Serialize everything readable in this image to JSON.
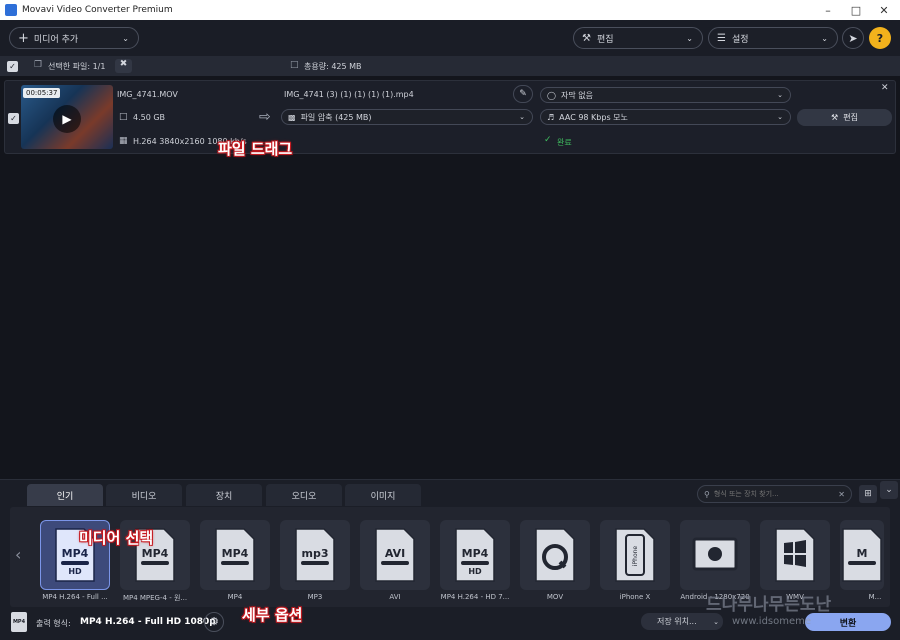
{
  "window": {
    "title": "Movavi Video Converter Premium"
  },
  "toolbar": {
    "add_media_label": "미디어 추가",
    "edit_label": "편집",
    "settings_label": "설정",
    "help_label": "?"
  },
  "selection_bar": {
    "selected_label": "선택한 파일: 1/1",
    "total_size_label": "총용량: 425 MB"
  },
  "file": {
    "duration": "00:05:37",
    "source_name": "IMG_4741.MOV",
    "source_size": "4.50 GB",
    "source_codec": "H.264 3840x2160 1080 kb/s",
    "output_name": "IMG_4741 (3) (1) (1) (1) (1).mp4",
    "compress_label": "파일 압축 (425 MB)",
    "subtitle_label": "자막 없음",
    "audio_label": "AAC 98 Kbps 모노",
    "edit_label": "편집",
    "status_label": "완료"
  },
  "annotations": {
    "file_drag": "파일 드래그",
    "media_select": "미디어 선택",
    "detail_options": "세부 옵션"
  },
  "tabs": [
    "인기",
    "비디오",
    "장치",
    "오디오",
    "이미지"
  ],
  "search": {
    "placeholder": "형식 또는 장치 찾기..."
  },
  "presets": [
    {
      "label": "MP4 H.264 - Full ...",
      "badge": "MP4"
    },
    {
      "label": "MP4 MPEG-4 - 원...",
      "badge": "MP4"
    },
    {
      "label": "MP4",
      "badge": "MP4"
    },
    {
      "label": "MP3",
      "badge": "mp3"
    },
    {
      "label": "AVI",
      "badge": "AVI"
    },
    {
      "label": "MP4 H.264 - HD 7...",
      "badge": "MP4"
    },
    {
      "label": "MOV",
      "badge": "Q"
    },
    {
      "label": "iPhone X",
      "badge": "iPhone"
    },
    {
      "label": "Android - 1280x720",
      "badge": "android"
    },
    {
      "label": "WMV",
      "badge": "windows"
    },
    {
      "label": "M...",
      "badge": "M"
    }
  ],
  "footer": {
    "output_format_prefix": "출력 형식:",
    "output_format_value": "MP4 H.264 - Full HD 1080p",
    "save_location_label": "저장 위치...",
    "convert_label": "변환"
  },
  "watermark": {
    "main": "드나무나무는도난",
    "sub": "www.idsomeme"
  },
  "colors": {
    "accent": "#7b95e8",
    "success": "#3fbf5f",
    "help": "#f2b21c",
    "overlay_outline": "#c4181e"
  }
}
